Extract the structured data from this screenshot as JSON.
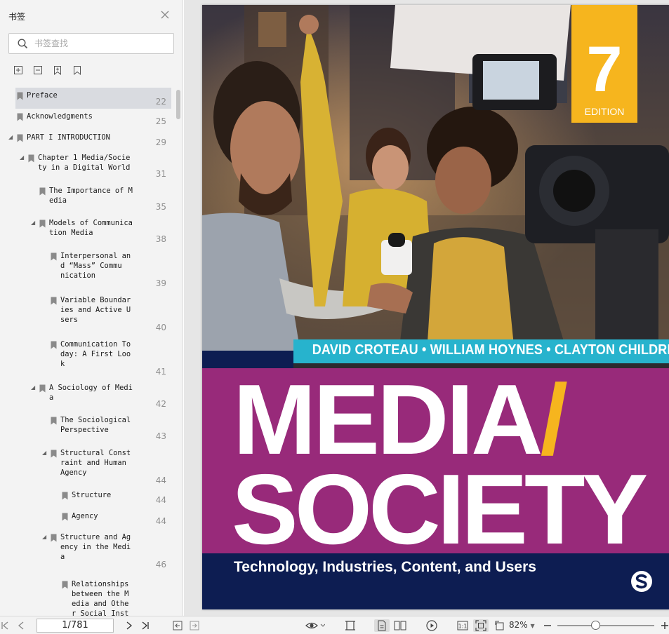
{
  "sidebar": {
    "title": "书签",
    "search_placeholder": "书签查找",
    "tools": [
      "expand-all-icon",
      "collapse-all-icon",
      "add-bookmark-icon",
      "bookmark-icon"
    ],
    "items": [
      {
        "level": 0,
        "expander": "",
        "lines": [
          "Preface"
        ],
        "page": "22",
        "selected": true
      },
      {
        "level": 0,
        "expander": "",
        "lines": [
          "Acknowledgments"
        ],
        "page": "25"
      },
      {
        "level": 0,
        "expander": "◢",
        "lines": [
          "PART I INTRODUCTION"
        ],
        "page": "29"
      },
      {
        "level": 1,
        "expander": "◢",
        "lines": [
          "Chapter 1 Media/Socie",
          "ty in a Digital World"
        ],
        "page": "31"
      },
      {
        "level": 2,
        "expander": "",
        "lines": [
          "The Importance of M",
          "edia"
        ],
        "page": "35"
      },
      {
        "level": 2,
        "expander": "◢",
        "lines": [
          "Models of Communica",
          "tion Media"
        ],
        "page": "38"
      },
      {
        "level": 3,
        "expander": "",
        "lines": [
          "Interpersonal an",
          "d “Mass” Commu",
          "nication"
        ],
        "page": "39"
      },
      {
        "level": 3,
        "expander": "",
        "lines": [
          "Variable Boundar",
          "ies and Active U",
          "sers"
        ],
        "page": "40"
      },
      {
        "level": 3,
        "expander": "",
        "lines": [
          "Communication To",
          "day: A First Loo",
          "k"
        ],
        "page": "41"
      },
      {
        "level": 2,
        "expander": "◢",
        "lines": [
          "A Sociology of Medi",
          "a"
        ],
        "page": "42"
      },
      {
        "level": 3,
        "expander": "",
        "lines": [
          "The Sociological",
          "Perspective"
        ],
        "page": "43"
      },
      {
        "level": 3,
        "expander": "◢",
        "lines": [
          "Structural Const",
          "raint and Human",
          "Agency"
        ],
        "page": "44"
      },
      {
        "level": 4,
        "expander": "",
        "lines": [
          "Structure"
        ],
        "page": "44"
      },
      {
        "level": 4,
        "expander": "",
        "lines": [
          "Agency"
        ],
        "page": "44"
      },
      {
        "level": 3,
        "expander": "◢",
        "lines": [
          "Structure and Ag",
          "ency in the Medi",
          "a"
        ],
        "page": "46"
      },
      {
        "level": 4,
        "expander": "",
        "lines": [
          "Relationships",
          "between the M",
          "edia and Othe",
          "r Social Inst"
        ],
        "page": ""
      }
    ]
  },
  "cover": {
    "edition_number": "7",
    "edition_label": "EDITION",
    "authors": "DAVID CROTEAU • WILLIAM HOYNES • CLAYTON CHILDRESS",
    "title_line1_a": "MEDIA",
    "title_line1_b": "/",
    "title_line2": "SOCIETY",
    "subtitle": "Technology, Industries, Content, and Users",
    "colors": {
      "magenta": "#982a7a",
      "navy": "#0d1d52",
      "teal": "#27b3cd",
      "gold": "#f6b51e"
    }
  },
  "toolbar": {
    "page_indicator": "1/781",
    "zoom": "82%",
    "zoom_fraction": 0.39,
    "buttons": [
      "first-page-icon",
      "prev-page-icon",
      "next-page-icon",
      "last-page-icon",
      "go-back-icon",
      "go-forward-icon",
      "eye-mode-icon",
      "fit-width-icon",
      "single-page-icon",
      "two-page-icon",
      "play-icon",
      "actual-size-icon",
      "fit-page-icon",
      "rotate-icon",
      "zoom-out-icon",
      "zoom-in-icon"
    ]
  }
}
